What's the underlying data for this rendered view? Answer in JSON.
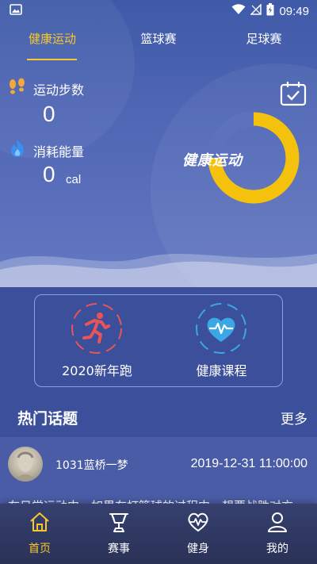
{
  "status_bar": {
    "time": "09:49"
  },
  "tabs": [
    {
      "label": "健康运动",
      "active": true
    },
    {
      "label": "篮球赛",
      "active": false
    },
    {
      "label": "足球赛",
      "active": false
    }
  ],
  "stats": {
    "steps": {
      "label": "运动步数",
      "value": "0"
    },
    "energy": {
      "label": "消耗能量",
      "value": "0",
      "unit": "cal"
    }
  },
  "ring": {
    "label": "健康运动"
  },
  "features": [
    {
      "label": "2020新年跑",
      "icon": "running-icon",
      "color": "#e8545a"
    },
    {
      "label": "健康课程",
      "icon": "heart-pulse-icon",
      "color": "#3aa7e6"
    }
  ],
  "hot_topics": {
    "title": "热门话题",
    "more_label": "更多",
    "post": {
      "author": "1031蓝桥一梦",
      "time": "2019-12-31 11:00:00",
      "snippet": "在日常运动中，如果在打篮球的过程中，想要战胜对方"
    }
  },
  "bottom_nav": [
    {
      "label": "首页",
      "icon": "home-icon",
      "active": true
    },
    {
      "label": "赛事",
      "icon": "trophy-icon",
      "active": false
    },
    {
      "label": "健身",
      "icon": "heart-pulse-icon",
      "active": false
    },
    {
      "label": "我的",
      "icon": "user-icon",
      "active": false
    }
  ],
  "colors": {
    "accent": "#f7c82b",
    "background": "#3c4f9a",
    "ring": "#f4c20d",
    "card_border": "#7fa6e6"
  }
}
